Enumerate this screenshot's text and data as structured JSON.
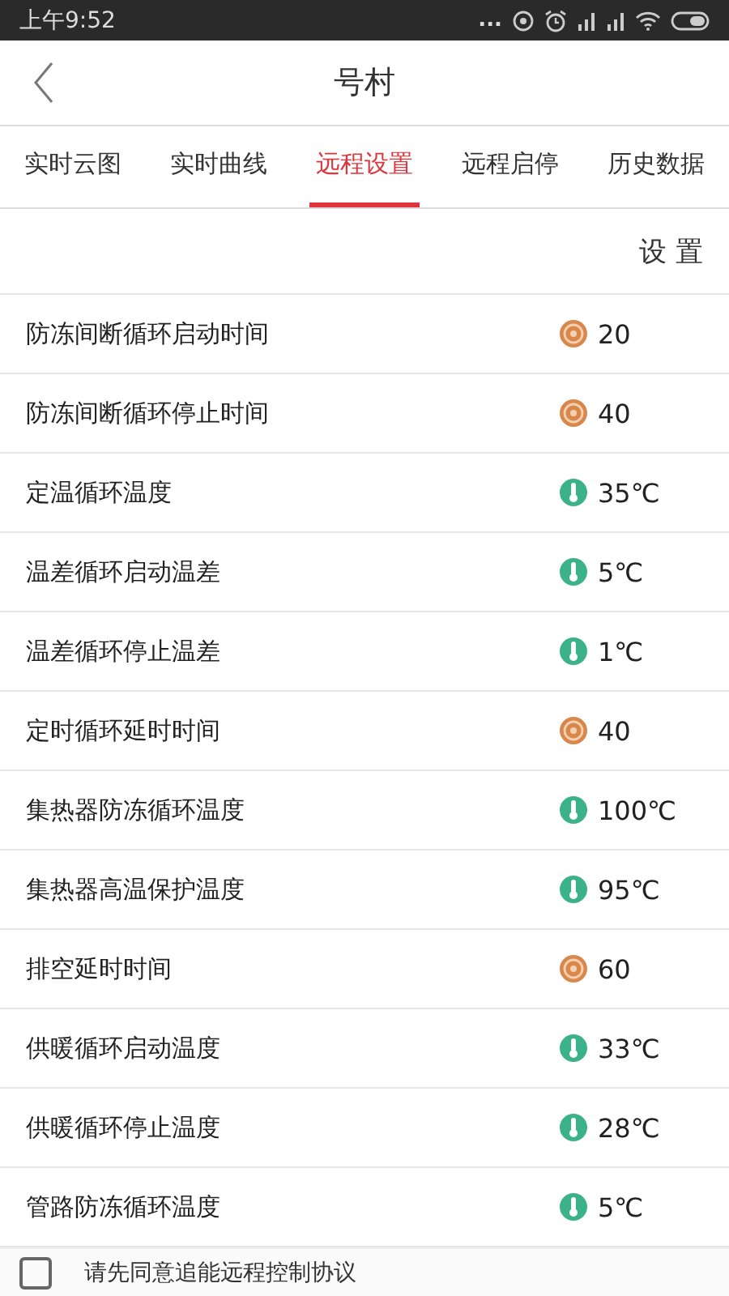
{
  "status_bar": {
    "time": "上午9:52",
    "dots": "..."
  },
  "header": {
    "title": "号村"
  },
  "tabs": [
    {
      "label": "实时云图",
      "selected": false
    },
    {
      "label": "实时曲线",
      "selected": false
    },
    {
      "label": "远程设置",
      "selected": true
    },
    {
      "label": "远程启停",
      "selected": false
    },
    {
      "label": "历史数据",
      "selected": false
    }
  ],
  "settings_button": "设 置",
  "rows": [
    {
      "label": "防冻间断循环启动时间",
      "kind": "dial",
      "value": "20"
    },
    {
      "label": "防冻间断循环停止时间",
      "kind": "dial",
      "value": "40"
    },
    {
      "label": "定温循环温度",
      "kind": "thermo",
      "value": "35℃"
    },
    {
      "label": "温差循环启动温差",
      "kind": "thermo",
      "value": "5℃"
    },
    {
      "label": "温差循环停止温差",
      "kind": "thermo",
      "value": "1℃"
    },
    {
      "label": "定时循环延时时间",
      "kind": "dial",
      "value": "40"
    },
    {
      "label": "集热器防冻循环温度",
      "kind": "thermo",
      "value": "100℃"
    },
    {
      "label": "集热器高温保护温度",
      "kind": "thermo",
      "value": "95℃"
    },
    {
      "label": "排空延时时间",
      "kind": "dial",
      "value": "60"
    },
    {
      "label": "供暖循环启动温度",
      "kind": "thermo",
      "value": "33℃"
    },
    {
      "label": "供暖循环停止温度",
      "kind": "thermo",
      "value": "28℃"
    },
    {
      "label": "管路防冻循环温度",
      "kind": "thermo",
      "value": "5℃"
    }
  ],
  "agreement": {
    "label": "请先同意追能远程控制协议",
    "checked": false
  }
}
